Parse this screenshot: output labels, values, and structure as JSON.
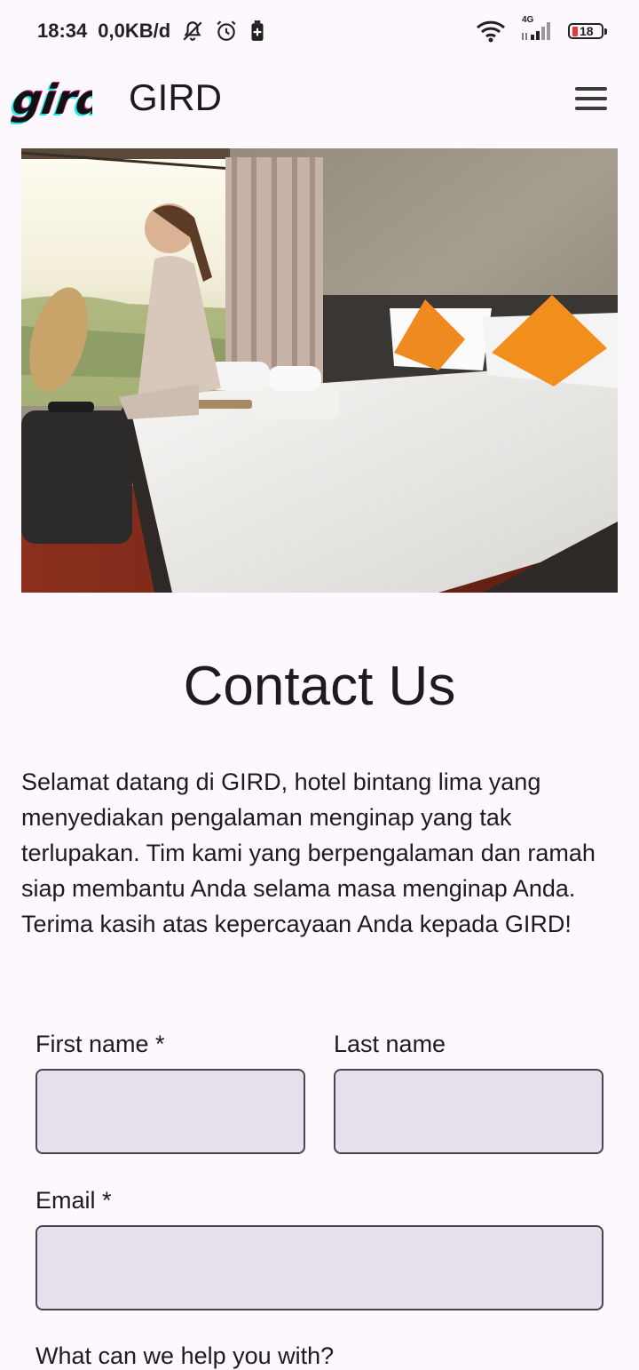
{
  "status_bar": {
    "time": "18:34",
    "speed": "0,0KB/d",
    "battery": "18",
    "network": "4G",
    "icons": [
      "mute-icon",
      "alarm-icon",
      "battery-saver-icon",
      "wifi-icon",
      "signal-icon",
      "battery-icon"
    ]
  },
  "appbar": {
    "logo_text": "gird",
    "title": "GIRD",
    "menu_icon": "hamburger-menu-icon"
  },
  "hero": {
    "image": "hotel-room-photo"
  },
  "content": {
    "heading": "Contact Us",
    "intro": "Selamat datang di GIRD, hotel bintang lima yang menyediakan pengalaman menginap yang tak terlupakan. Tim kami yang berpengalaman dan ramah siap membantu Anda selama masa menginap Anda. Terima kasih atas kepercayaan Anda kepada GIRD!"
  },
  "form": {
    "first_name_label": "First name *",
    "first_name_value": "",
    "last_name_label": "Last name",
    "last_name_value": "",
    "email_label": "Email *",
    "email_value": "",
    "next_label": "What can we help you with?"
  },
  "colors": {
    "background": "#fdf8fd",
    "field_fill": "#e7e0ec",
    "field_border": "#49454f",
    "text": "#1d1b20"
  }
}
